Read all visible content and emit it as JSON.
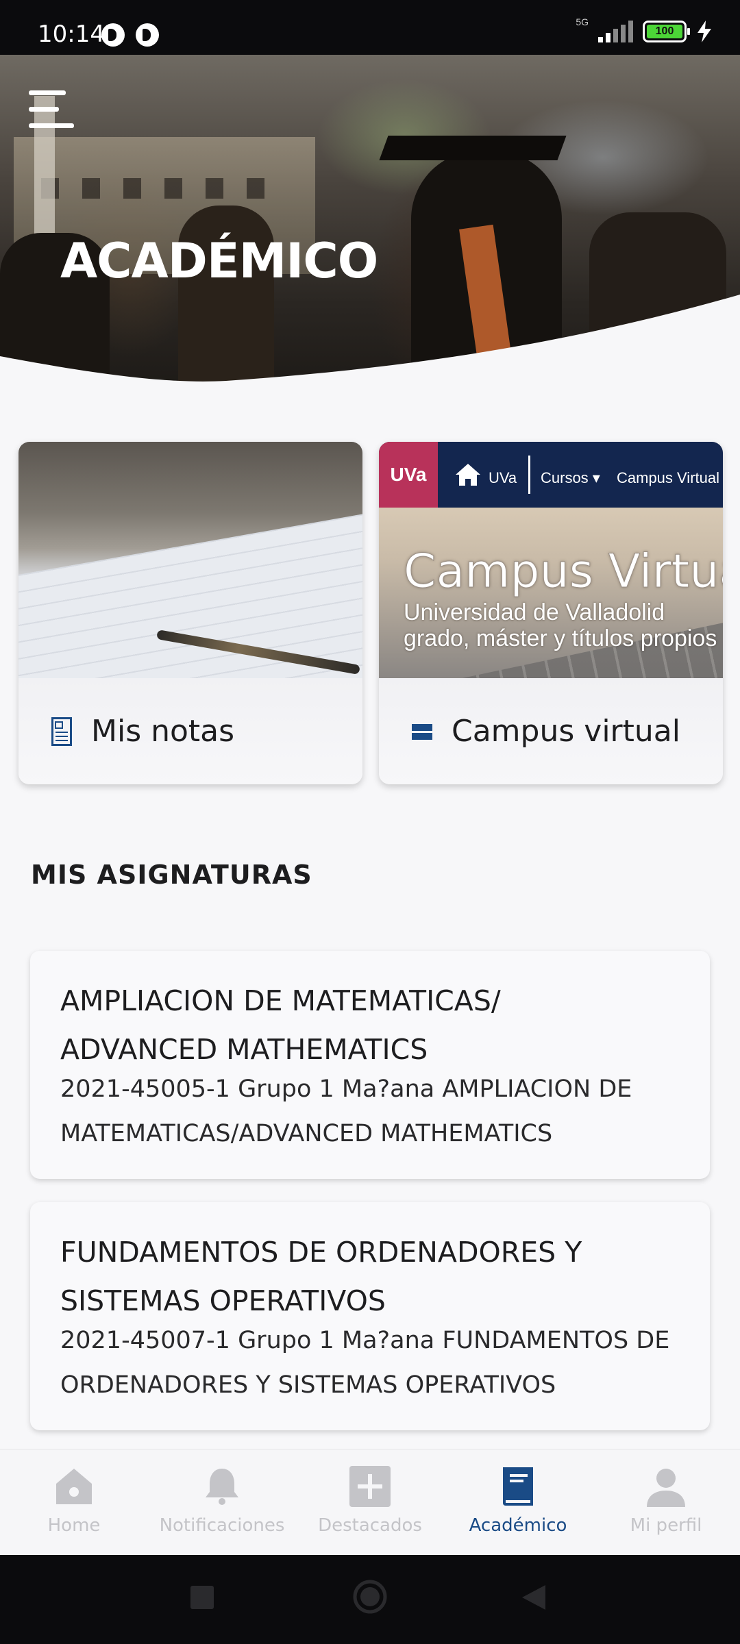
{
  "status_bar": {
    "time": "10:14",
    "network": "5G",
    "battery": "100"
  },
  "hero": {
    "title": "ACADÉMICO"
  },
  "quick_cards": [
    {
      "label": "Mis notas",
      "icon": "document-icon"
    },
    {
      "label": "Campus virtual",
      "icon": "campus-icon",
      "image_text": {
        "logo": "UVa",
        "nav_uva": "UVa",
        "nav_cursos": "Cursos ▾",
        "nav_campus": "Campus Virtual",
        "headline": "Campus Virtual",
        "subtitle_1": "Universidad de Valladolid",
        "subtitle_2": "grado, máster y títulos propios"
      }
    }
  ],
  "section": {
    "title": "MIS ASIGNATURAS"
  },
  "subjects": [
    {
      "title_line1": "AMPLIACION DE MATEMATICAS/",
      "title_line2": "ADVANCED MATHEMATICS",
      "code_line1": "2021-45005-1 Grupo 1 Ma?ana AMPLIACION DE",
      "code_line2": "MATEMATICAS/ADVANCED MATHEMATICS"
    },
    {
      "title_line1": "FUNDAMENTOS DE ORDENADORES Y",
      "title_line2": "SISTEMAS OPERATIVOS",
      "code_line1": "2021-45007-1 Grupo 1 Ma?ana FUNDAMENTOS DE",
      "code_line2": "ORDENADORES Y SISTEMAS OPERATIVOS"
    }
  ],
  "bottom_nav": {
    "items": [
      {
        "label": "Home",
        "icon": "home-icon",
        "active": false
      },
      {
        "label": "Notificaciones",
        "icon": "bell-icon",
        "active": false
      },
      {
        "label": "Destacados",
        "icon": "plus-icon",
        "active": false
      },
      {
        "label": "Académico",
        "icon": "book-icon",
        "active": true
      },
      {
        "label": "Mi perfil",
        "icon": "user-icon",
        "active": false
      }
    ]
  },
  "colors": {
    "accent": "#1a4b86",
    "inactive": "#c4c4c8",
    "uva_brand": "#b8325a",
    "campus_bar": "#13264f"
  }
}
